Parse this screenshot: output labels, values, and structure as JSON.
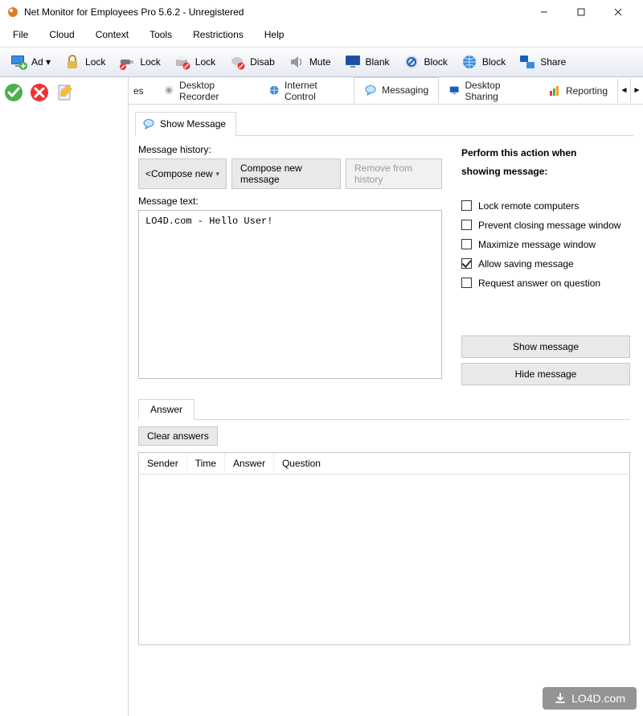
{
  "window": {
    "title": "Net Monitor for Employees Pro 5.6.2 - Unregistered"
  },
  "menu": [
    "File",
    "Cloud",
    "Context",
    "Tools",
    "Restrictions",
    "Help"
  ],
  "toolbar": [
    {
      "label": "Ad ▾"
    },
    {
      "label": "Lock"
    },
    {
      "label": "Lock"
    },
    {
      "label": "Lock"
    },
    {
      "label": "Disab"
    },
    {
      "label": "Mute"
    },
    {
      "label": "Blank"
    },
    {
      "label": "Block"
    },
    {
      "label": "Block"
    },
    {
      "label": "Share"
    }
  ],
  "main_tabs": {
    "partial": "es",
    "items": [
      {
        "label": "Desktop Recorder"
      },
      {
        "label": "Internet Control"
      },
      {
        "label": "Messaging",
        "active": true
      },
      {
        "label": "Desktop Sharing"
      },
      {
        "label": "Reporting"
      }
    ]
  },
  "sub_tab": {
    "label": "Show Message"
  },
  "message": {
    "history_label": "Message history:",
    "select_value": "<Compose new",
    "compose_btn": "Compose new message",
    "remove_btn": "Remove from history",
    "text_label": "Message text:",
    "text_value": "LO4D.com - Hello User!"
  },
  "action_panel": {
    "heading_line1": "Perform this action when",
    "heading_line2": "showing message:",
    "checks": [
      {
        "label": "Lock remote computers",
        "checked": false
      },
      {
        "label": "Prevent closing message window",
        "checked": false
      },
      {
        "label": "Maximize message window",
        "checked": false
      },
      {
        "label": "Allow saving message",
        "checked": true
      },
      {
        "label": "Request answer on question",
        "checked": false
      }
    ],
    "show_btn": "Show message",
    "hide_btn": "Hide message"
  },
  "answer": {
    "tab": "Answer",
    "clear_btn": "Clear answers",
    "columns": [
      "Sender",
      "Time",
      "Answer",
      "Question"
    ]
  },
  "watermark": "LO4D.com"
}
